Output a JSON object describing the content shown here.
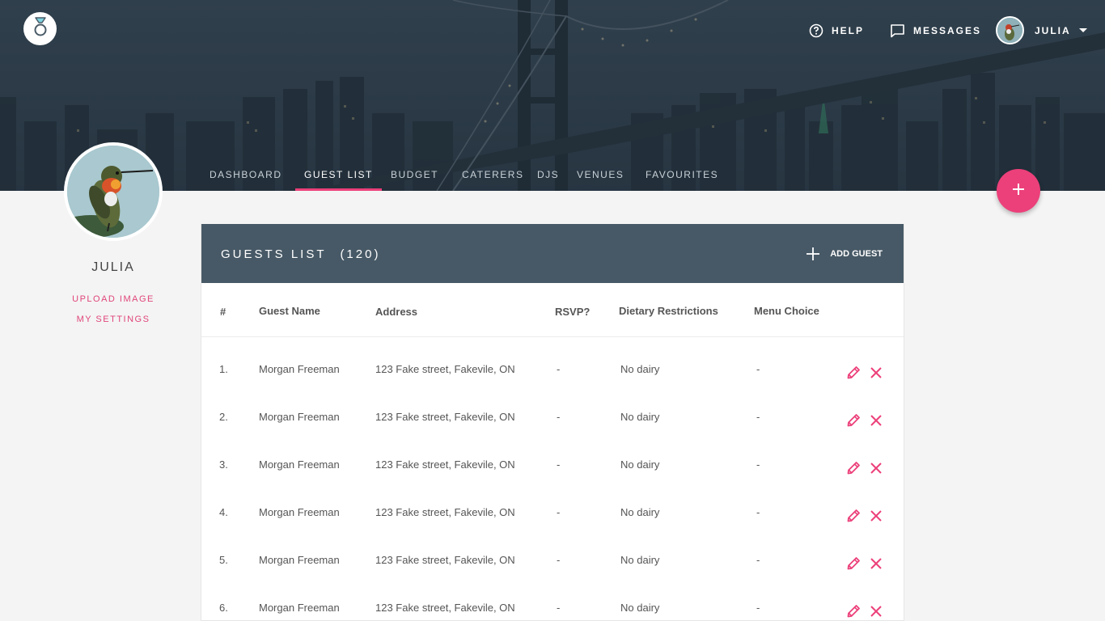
{
  "top_nav": {
    "help": "HELP",
    "messages": "MESSAGES",
    "user_name": "JULIA"
  },
  "tabs": [
    {
      "label": "DASHBOARD",
      "active": false
    },
    {
      "label": "GUEST LIST",
      "active": true
    },
    {
      "label": "BUDGET",
      "active": false
    },
    {
      "label": "CATERERS",
      "active": false
    },
    {
      "label": "DJS",
      "active": false
    },
    {
      "label": "VENUES",
      "active": false
    },
    {
      "label": "FAVOURITES",
      "active": false
    }
  ],
  "profile": {
    "name": "JULIA",
    "upload_image": "UPLOAD IMAGE",
    "my_settings": "MY SETTINGS"
  },
  "guest_list": {
    "title": "GUESTS LIST",
    "count": "(120)",
    "add_label": "ADD GUEST",
    "columns": [
      "#",
      "Guest Name",
      "Address",
      "RSVP?",
      "Dietary Restrictions",
      "Menu Choice"
    ],
    "rows": [
      {
        "num": "1.",
        "name": "Morgan Freeman",
        "address": "123 Fake street, Fakevile, ON",
        "rsvp": "-",
        "dietary": "No dairy",
        "menu": "-"
      },
      {
        "num": "2.",
        "name": "Morgan Freeman",
        "address": "123 Fake street, Fakevile, ON",
        "rsvp": "-",
        "dietary": "No dairy",
        "menu": "-"
      },
      {
        "num": "3.",
        "name": "Morgan Freeman",
        "address": "123 Fake street, Fakevile, ON",
        "rsvp": "-",
        "dietary": "No dairy",
        "menu": "-"
      },
      {
        "num": "4.",
        "name": "Morgan Freeman",
        "address": "123 Fake street, Fakevile, ON",
        "rsvp": "-",
        "dietary": "No dairy",
        "menu": "-"
      },
      {
        "num": "5.",
        "name": "Morgan Freeman",
        "address": "123 Fake street, Fakevile, ON",
        "rsvp": "-",
        "dietary": "No dairy",
        "menu": "-"
      },
      {
        "num": "6.",
        "name": "Morgan Freeman",
        "address": "123 Fake street, Fakevile, ON",
        "rsvp": "-",
        "dietary": "No dairy",
        "menu": "-"
      }
    ]
  },
  "colors": {
    "accent": "#ec407a",
    "header_bar": "#475966",
    "hero": "#2c3e4c"
  },
  "icons": {
    "logo": "ring-icon",
    "help": "question-circle-icon",
    "messages": "chat-bubble-icon",
    "add": "plus-icon",
    "edit": "pencil-icon",
    "delete": "close-icon"
  }
}
